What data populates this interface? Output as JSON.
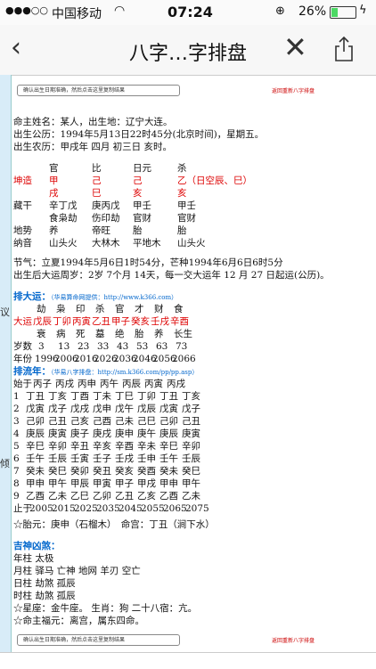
{
  "status": {
    "signal": "●●●○○",
    "carrier": "中国移动",
    "wifi_icon": "wifi-icon",
    "time": "07:24",
    "battery": "26%",
    "battery_level": 0.26
  },
  "nav": {
    "back": "‹",
    "title": "八字…字排盘",
    "close": "✕"
  },
  "top": {
    "button": "确认出生日期准确，然后点击这里复制结果",
    "link": "返回重新八字排盘"
  },
  "info": {
    "line1": "命主姓名：某人，出生地：辽宁大连。",
    "line2": "出生公历：1994年5月13日22时45分(北京时间)，星期五。",
    "line3": "出生农历：甲戌年 四月 初三日 亥时。"
  },
  "pillars": {
    "shishen": [
      "官",
      "比",
      "日元",
      "杀"
    ],
    "label_kun": "坤造",
    "tiangan": [
      "甲",
      "己",
      "己",
      "乙（日空辰、巳）"
    ],
    "dizhi": [
      "戌",
      "巳",
      "亥",
      "亥"
    ],
    "canggan_label": "藏干",
    "canggan1": [
      "辛丁戊",
      "庚丙戊",
      "甲壬",
      "甲壬"
    ],
    "canggan2": [
      "食枭劫",
      "伤印劫",
      "官财",
      "官财"
    ],
    "dishi_label": "地势",
    "dishi": [
      "养",
      "帝旺",
      "胎",
      "胎"
    ],
    "nayin_label": "纳音",
    "nayin": [
      "山头火",
      "大林木",
      "平地木",
      "山头火"
    ]
  },
  "jieqi": {
    "line1": "节气：立夏1994年5月6日1时54分，芒种1994年6月6日6时5分",
    "line2": "出生后大运周岁：2岁 7个月 14天，每一交大运年 12 月 27 日起运(公历)。"
  },
  "dayun": {
    "title": "排大运：",
    "source": "（华易算命网提供：http://www.k366.com）",
    "shishen": [
      "劫",
      "枭",
      "印",
      "杀",
      "官",
      "才",
      "财",
      "食"
    ],
    "label": "大运",
    "ganzhi": [
      "戊辰",
      "丁卯",
      "丙寅",
      "乙丑",
      "甲子",
      "癸亥",
      "壬戌",
      "辛酉"
    ],
    "dishi": [
      "衰",
      "病",
      "死",
      "墓",
      "绝",
      "胎",
      "养",
      "长生"
    ],
    "age_label": "岁数",
    "ages": [
      "3",
      "13",
      "23",
      "33",
      "43",
      "53",
      "63",
      "73"
    ],
    "year_label": "年份",
    "years": [
      "1996",
      "2006",
      "2016",
      "2026",
      "2036",
      "2046",
      "2056",
      "2066"
    ]
  },
  "liunian": {
    "title": "排流年：",
    "source": "（华易八字排盘：http://sm.k366.com/pp/pp.asp）",
    "start_label": "始于",
    "start": [
      "丙子",
      "丙戌",
      "丙申",
      "丙午",
      "丙辰",
      "丙寅",
      "丙戌"
    ],
    "rows": [
      [
        "1",
        "丁丑",
        "丁亥",
        "丁酉",
        "丁未",
        "丁巳",
        "丁卯",
        "丁丑",
        "丁亥"
      ],
      [
        "2",
        "戊寅",
        "戊子",
        "戊戌",
        "戊申",
        "戊午",
        "戊辰",
        "戊寅",
        "戊子"
      ],
      [
        "3",
        "己卯",
        "己丑",
        "己亥",
        "己酉",
        "己未",
        "己巳",
        "己卯",
        "己丑"
      ],
      [
        "4",
        "庚辰",
        "庚寅",
        "庚子",
        "庚戌",
        "庚申",
        "庚午",
        "庚辰",
        "庚寅"
      ],
      [
        "5",
        "辛巳",
        "辛卯",
        "辛丑",
        "辛亥",
        "辛酉",
        "辛未",
        "辛巳",
        "辛卯"
      ],
      [
        "6",
        "壬午",
        "壬辰",
        "壬寅",
        "壬子",
        "壬戌",
        "壬申",
        "壬午",
        "壬辰"
      ],
      [
        "7",
        "癸未",
        "癸巳",
        "癸卯",
        "癸丑",
        "癸亥",
        "癸酉",
        "癸未",
        "癸巳"
      ],
      [
        "8",
        "甲申",
        "甲午",
        "甲辰",
        "甲寅",
        "甲子",
        "甲戌",
        "甲申",
        "甲午"
      ],
      [
        "9",
        "乙酉",
        "乙未",
        "乙巳",
        "乙卯",
        "乙丑",
        "乙亥",
        "乙酉",
        "乙未"
      ]
    ],
    "end_label": "止于",
    "end": [
      "2005",
      "2015",
      "2025",
      "2035",
      "2045",
      "2055",
      "2065",
      "2075"
    ]
  },
  "taiyuan": "☆胎元：庚申（石榴木）　命宫：丁丑（涧下水）",
  "shensha": {
    "title": "吉神凶煞：",
    "lines": [
      "年柱 太极",
      "月柱 驿马 亡神 地网 羊刃 空亡",
      "日柱 劫煞 孤辰",
      "时柱 劫煞 孤辰",
      "☆星座：金牛座。 生肖：狗 二十八宿：亢。",
      "☆命主福元：离宫，属东四命。"
    ]
  },
  "sidebar": {
    "a": "议",
    "b": "倾"
  }
}
